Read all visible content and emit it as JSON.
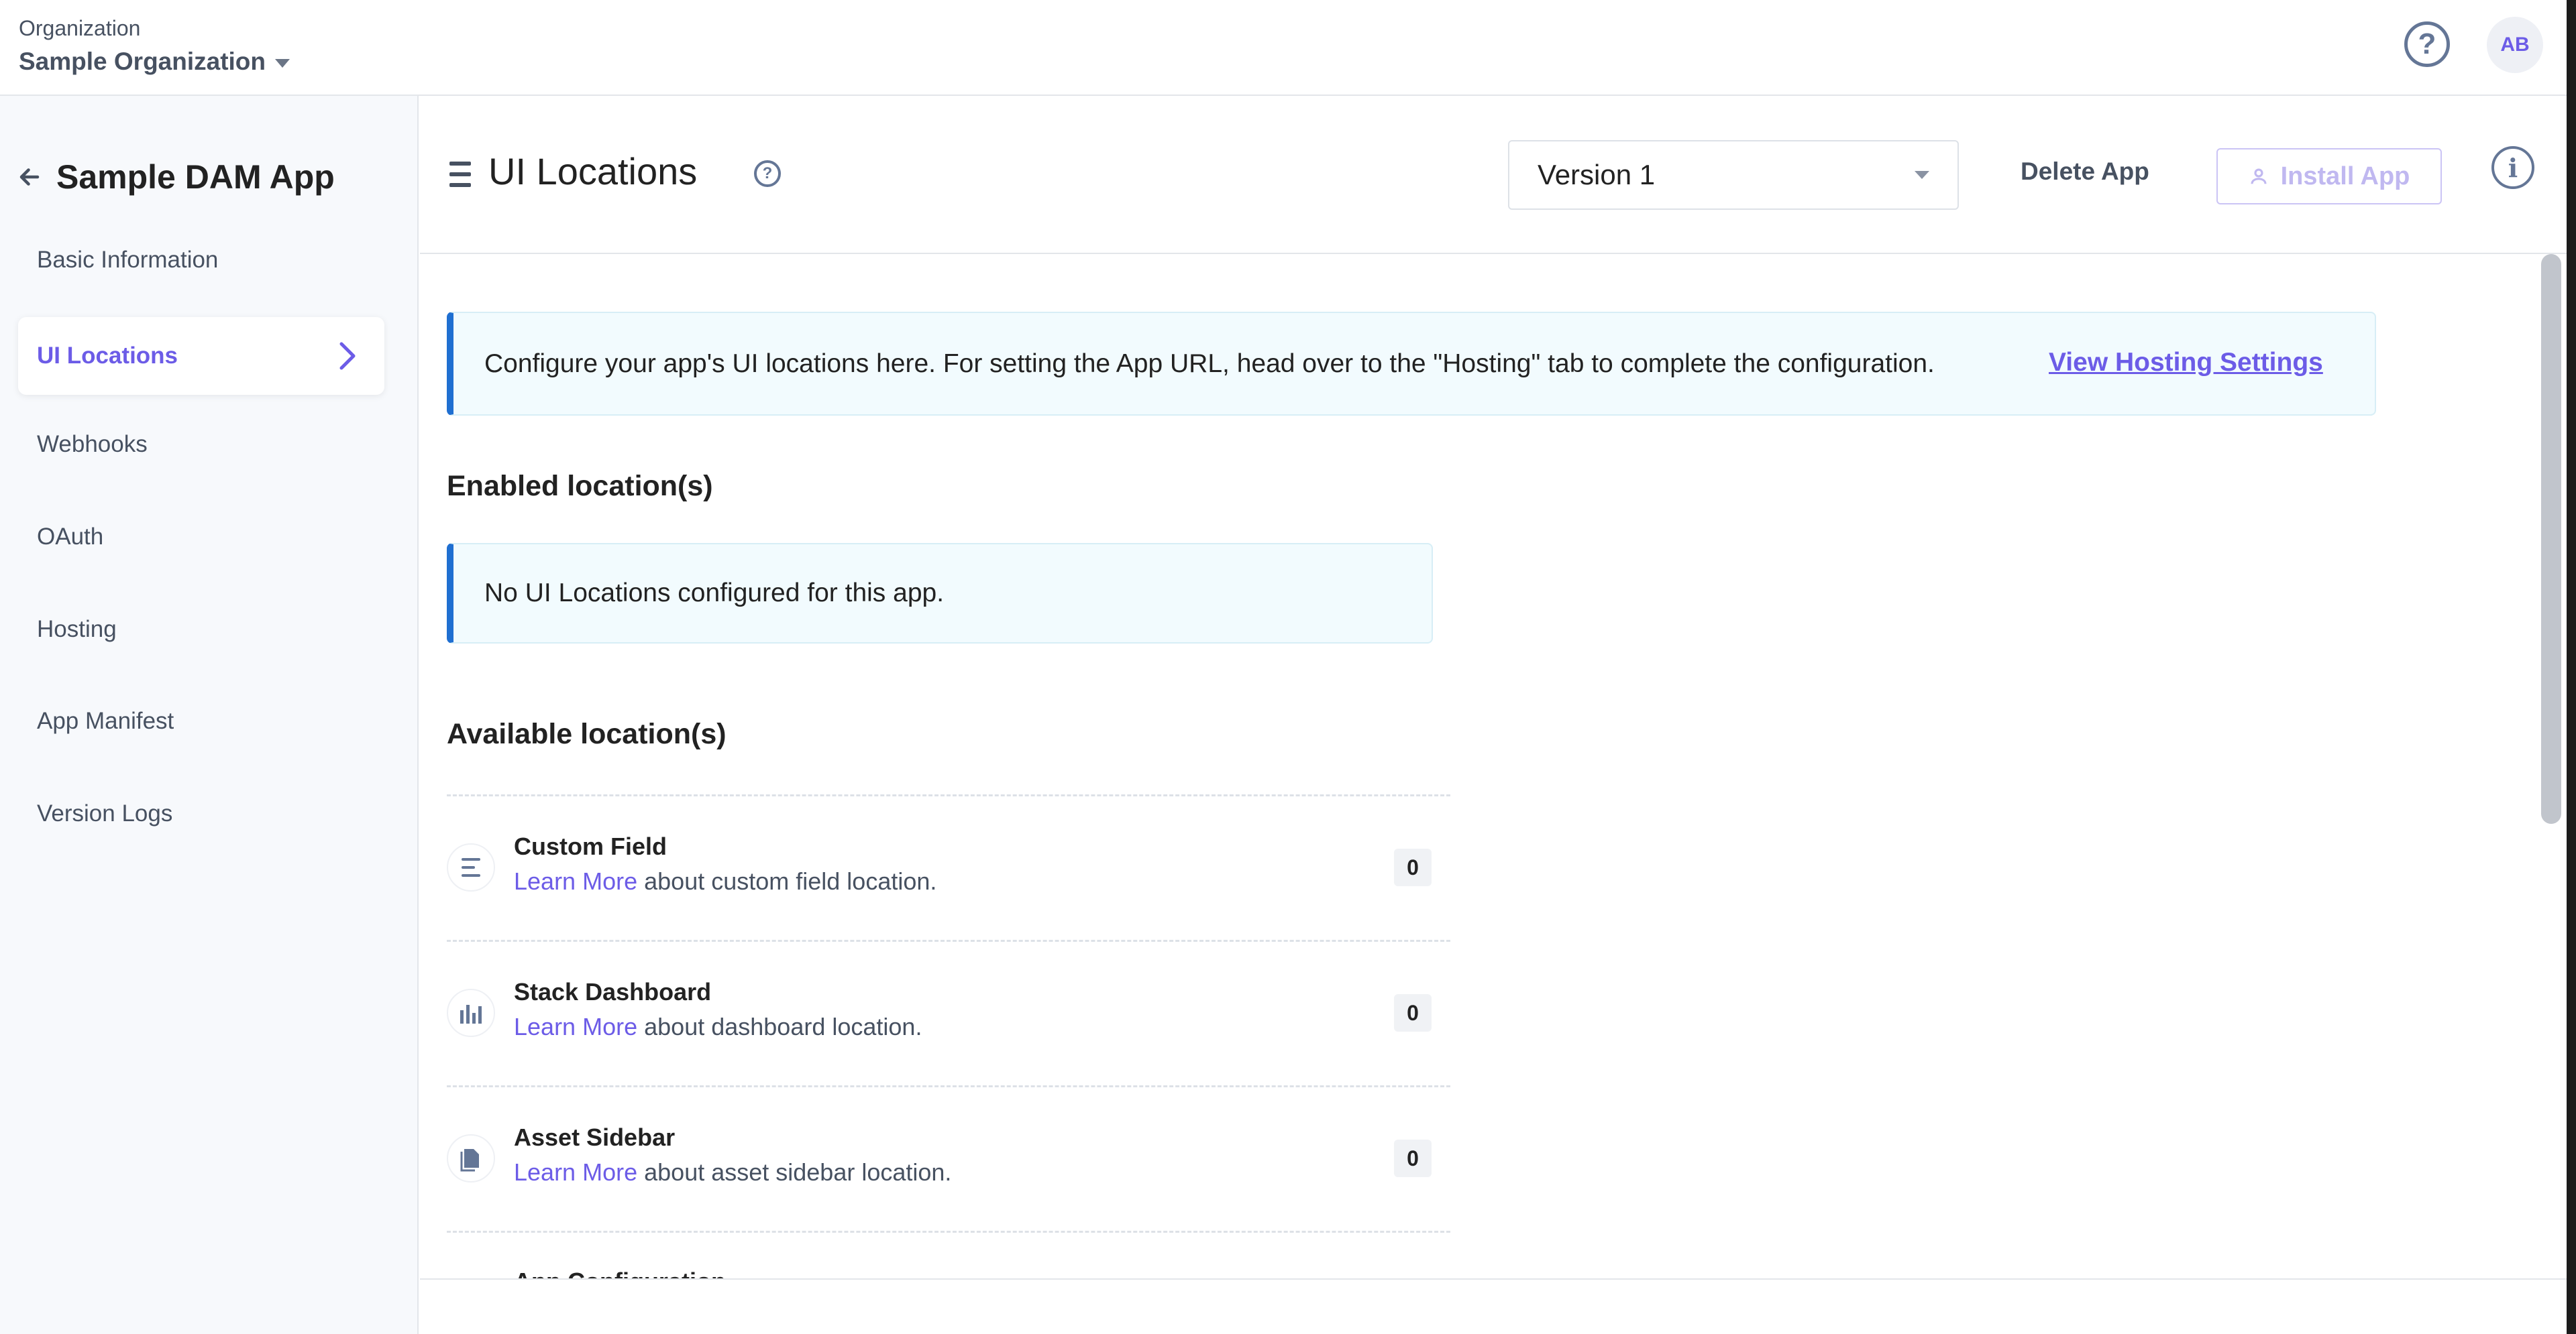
{
  "topbar": {
    "org_label": "Organization",
    "org_name": "Sample Organization",
    "help_icon": "question-circle-icon",
    "avatar_initials": "AB"
  },
  "sidebar": {
    "app_title": "Sample DAM App",
    "items": [
      {
        "label": "Basic Information",
        "active": false
      },
      {
        "label": "UI Locations",
        "active": true
      },
      {
        "label": "Webhooks",
        "active": false
      },
      {
        "label": "OAuth",
        "active": false
      },
      {
        "label": "Hosting",
        "active": false
      },
      {
        "label": "App Manifest",
        "active": false
      },
      {
        "label": "Version Logs",
        "active": false
      }
    ]
  },
  "header": {
    "title": "UI Locations",
    "version": "Version 1",
    "delete_label": "Delete App",
    "install_label": "Install App"
  },
  "content": {
    "banner_text": "Configure your app's UI locations here. For setting the App URL, head over to the \"Hosting\" tab to complete the configuration.",
    "banner_link": "View Hosting Settings",
    "enabled_heading": "Enabled location(s)",
    "empty_text": "No UI Locations configured for this app.",
    "available_heading": "Available location(s)",
    "learn_more": "Learn More",
    "locations": [
      {
        "name": "Custom Field",
        "desc": "about custom field location.",
        "count": "0",
        "icon": "custom-field-icon"
      },
      {
        "name": "Stack Dashboard",
        "desc": "about dashboard location.",
        "count": "0",
        "icon": "dashboard-icon"
      },
      {
        "name": "Asset Sidebar",
        "desc": "about asset sidebar location.",
        "count": "0",
        "icon": "asset-sidebar-icon"
      },
      {
        "name": "App Configuration",
        "desc": "",
        "count": "",
        "icon": "app-config-icon"
      }
    ]
  },
  "colors": {
    "accent": "#6c5ce7",
    "info_border": "#1f6fd1",
    "info_bg": "#f2fbfe",
    "text_muted": "#475161"
  }
}
